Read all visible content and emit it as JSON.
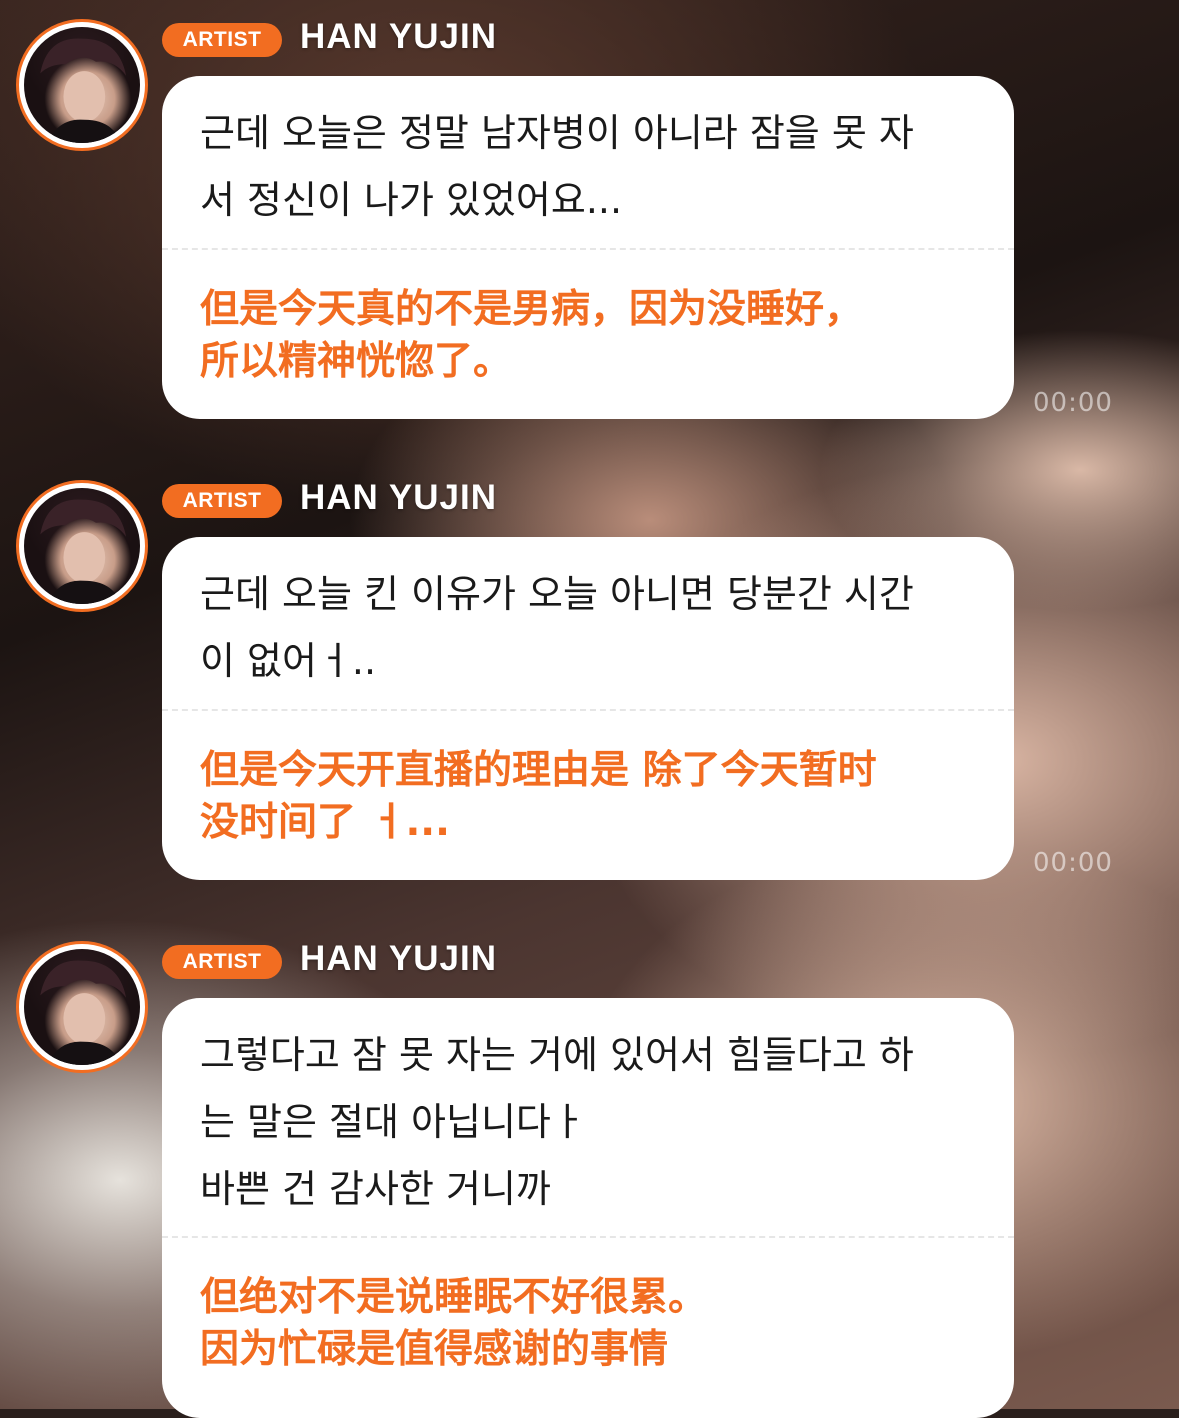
{
  "colors": {
    "accent": "#f26d21",
    "bubble": "#ffffff",
    "korean_text": "#1a1a1a",
    "translation_text": "#f26d21"
  },
  "timestamps": [
    "00:00",
    "00:00"
  ],
  "messages": [
    {
      "badge": "ARTIST",
      "name": "HAN YUJIN",
      "korean": "근데 오늘은 정말 남자병이 아니라 잠을 못 자\n서 정신이 나가 있었어요...",
      "chinese": "但是今天真的不是男病，因为没睡好，\n所以精神恍惚了。"
    },
    {
      "badge": "ARTIST",
      "name": "HAN YUJIN",
      "korean": "근데 오늘 킨 이유가 오늘 아니면 당분간 시간\n이 없어ㅓ..",
      "chinese": "但是今天开直播的理由是 除了今天暂时\n没时间了 ㅓ..."
    },
    {
      "badge": "ARTIST",
      "name": "HAN YUJIN",
      "korean": "그렇다고 잠 못 자는 거에 있어서 힘들다고 하\n는 말은 절대 아닙니다ㅏ\n바쁜 건 감사한 거니까",
      "chinese": "但绝对不是说睡眠不好很累。\n因为忙碌是值得感谢的事情"
    }
  ]
}
